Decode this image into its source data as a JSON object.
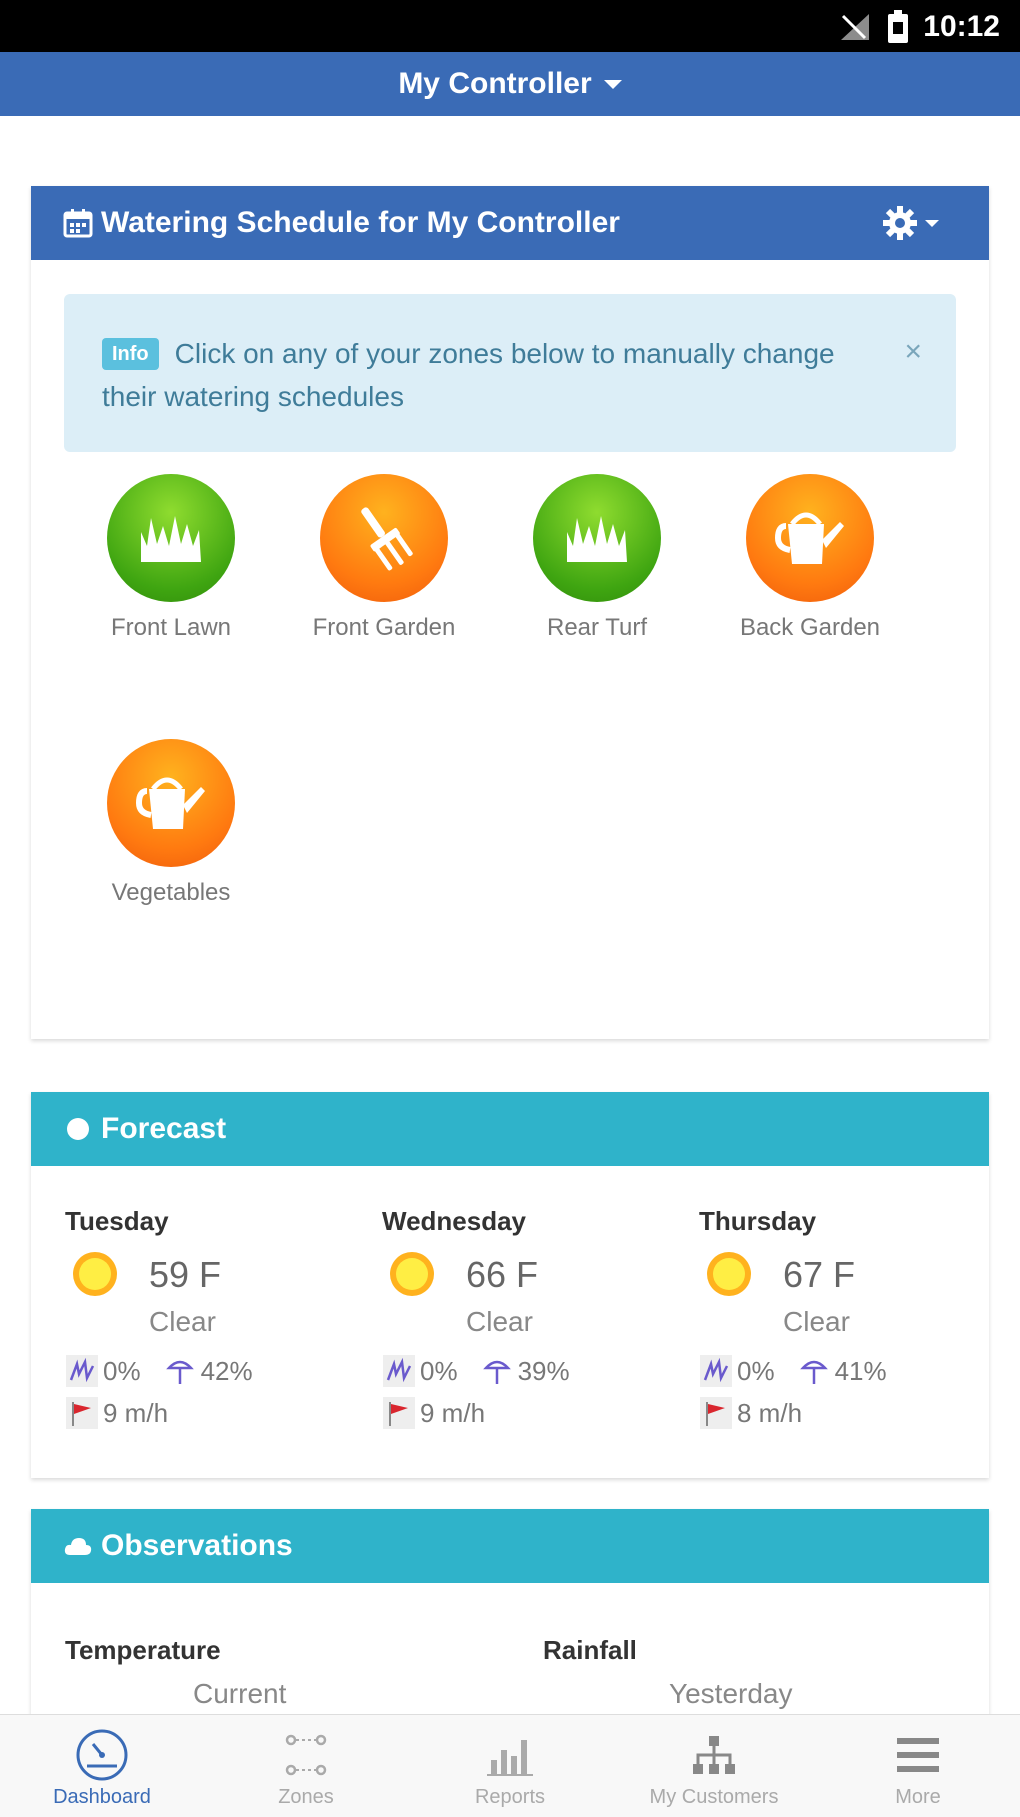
{
  "status_bar": {
    "time": "10:12"
  },
  "top_bar": {
    "title": "My Controller"
  },
  "schedule": {
    "title": "Watering Schedule for My Controller",
    "alert": {
      "badge": "Info",
      "text": "Click on any of your zones below to manually change their watering schedules",
      "close": "×"
    },
    "zones": [
      {
        "label": "Front Lawn",
        "icon": "grass-icon",
        "color": "#3fa511"
      },
      {
        "label": "Front Garden",
        "icon": "garden-tool-icon",
        "color": "#ff7a10"
      },
      {
        "label": "Rear Turf",
        "icon": "grass-icon",
        "color": "#3fa511"
      },
      {
        "label": "Back Garden",
        "icon": "watering-can-icon",
        "color": "#ff7a10"
      },
      {
        "label": "Vegetables",
        "icon": "watering-can-icon",
        "color": "#ff7a10"
      }
    ]
  },
  "forecast": {
    "title": "Forecast",
    "days": [
      {
        "name": "Tuesday",
        "temp": "59 F",
        "condition": "Clear",
        "precip": "0%",
        "humidity": "42%",
        "wind": "9 m/h"
      },
      {
        "name": "Wednesday",
        "temp": "66 F",
        "condition": "Clear",
        "precip": "0%",
        "humidity": "39%",
        "wind": "9 m/h"
      },
      {
        "name": "Thursday",
        "temp": "67 F",
        "condition": "Clear",
        "precip": "0%",
        "humidity": "41%",
        "wind": "8 m/h"
      }
    ]
  },
  "observations": {
    "title": "Observations",
    "temperature": {
      "heading": "Temperature",
      "sub": "Current"
    },
    "rainfall": {
      "heading": "Rainfall",
      "sub": "Yesterday"
    }
  },
  "bottom_nav": {
    "items": [
      {
        "label": "Dashboard",
        "active": true
      },
      {
        "label": "Zones",
        "active": false
      },
      {
        "label": "Reports",
        "active": false
      },
      {
        "label": "My Customers",
        "active": false
      },
      {
        "label": "More",
        "active": false
      }
    ]
  },
  "colors": {
    "primary": "#3a6bb6",
    "teal": "#2fb3ca",
    "green": "#3fa511",
    "orange": "#ff7a10",
    "info_bg": "#dceef7"
  }
}
